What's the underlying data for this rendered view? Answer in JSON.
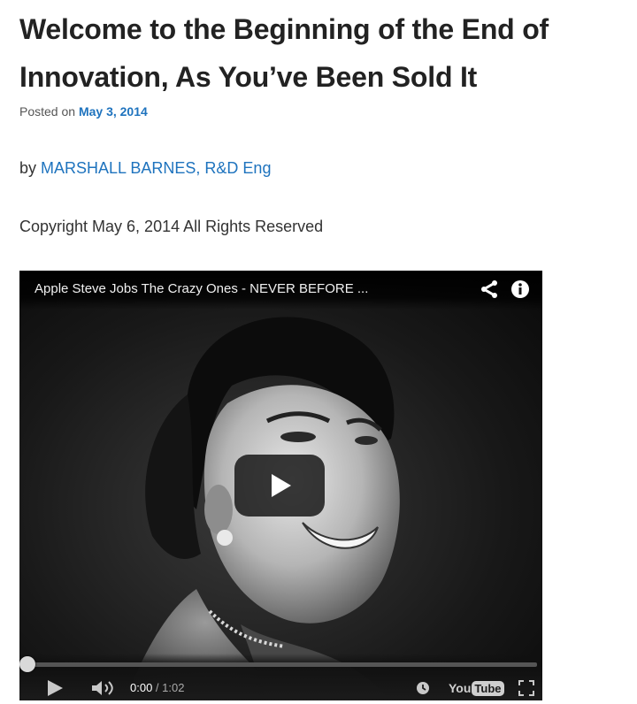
{
  "post": {
    "title": "Welcome to the Beginning of the End of Innovation, As You’ve Been Sold It",
    "posted_on_label": "Posted on",
    "date": "May 3, 2014",
    "by_label": "by",
    "author": "MARSHALL BARNES, R&D Eng",
    "copyright": "Copyright May 6, 2014 All Rights Reserved"
  },
  "video": {
    "title": "Apple Steve Jobs The Crazy Ones - NEVER BEFORE ...",
    "current_time": "0:00",
    "time_separator": " / ",
    "duration": "1:02",
    "progress": 0,
    "logo_you": "You",
    "logo_tube": "Tube",
    "icons": [
      "share-icon",
      "info-icon",
      "play-icon",
      "volume-icon",
      "watch-later-icon",
      "fullscreen-icon"
    ],
    "colors": {
      "progress_played": "#cc181e",
      "link": "#1e73be"
    }
  }
}
